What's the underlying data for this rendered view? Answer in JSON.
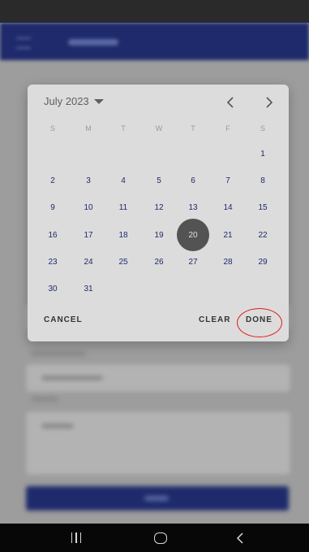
{
  "date_picker": {
    "month_label": "July 2023",
    "weekdays": [
      "S",
      "M",
      "T",
      "W",
      "T",
      "F",
      "S"
    ],
    "first_weekday_index": 6,
    "days_in_month": 31,
    "selected_day": 20,
    "actions": {
      "cancel": "CANCEL",
      "clear": "CLEAR",
      "done": "DONE"
    }
  },
  "colors": {
    "accent": "#1e2a6b",
    "selected_day_bg": "#535353",
    "highlight_ring": "#e01b1b"
  },
  "icons": {
    "month_dropdown": "caret-down-icon",
    "prev": "chevron-left-icon",
    "next": "chevron-right-icon",
    "nav_recents": "recents-icon",
    "nav_home": "home-icon",
    "nav_back": "back-icon"
  }
}
